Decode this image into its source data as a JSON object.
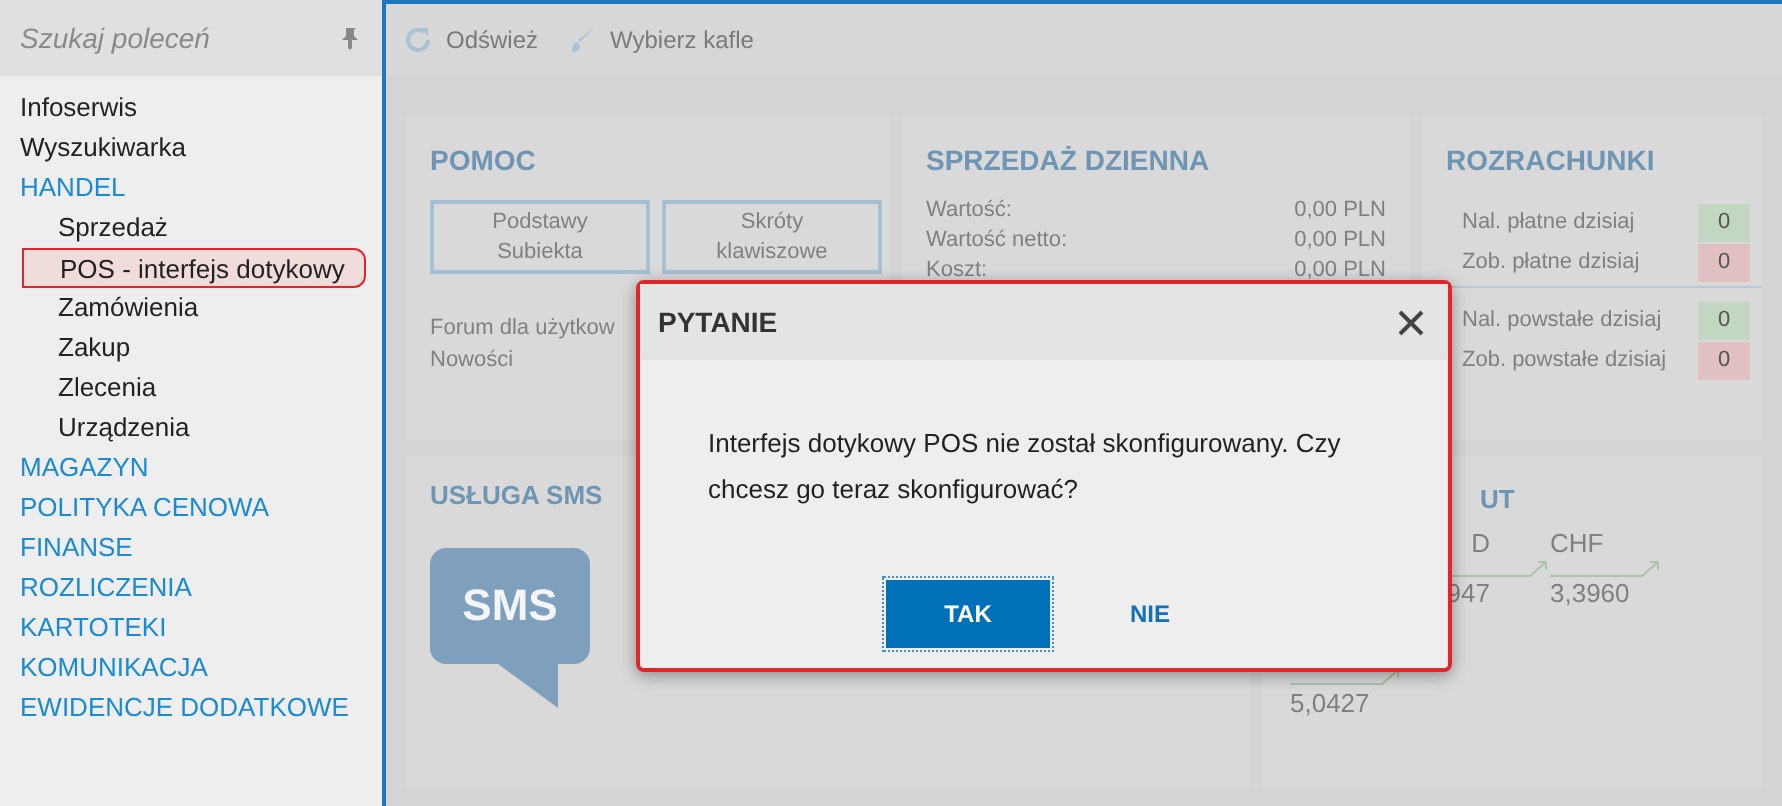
{
  "sidebar": {
    "search": {
      "placeholder": "Szukaj poleceń"
    },
    "items": [
      {
        "label": "Infoserwis",
        "kind": "link",
        "selected": false
      },
      {
        "label": "Wyszukiwarka",
        "kind": "link",
        "selected": false
      },
      {
        "label": "HANDEL",
        "kind": "group",
        "selected": false,
        "children": [
          {
            "label": "Sprzedaż",
            "selected": false
          },
          {
            "label": "POS - interfejs dotykowy",
            "selected": true
          },
          {
            "label": "Zamówienia",
            "selected": false
          },
          {
            "label": "Zakup",
            "selected": false
          },
          {
            "label": "Zlecenia",
            "selected": false
          },
          {
            "label": "Urządzenia",
            "selected": false
          }
        ]
      },
      {
        "label": "MAGAZYN",
        "kind": "group",
        "selected": false
      },
      {
        "label": "POLITYKA CENOWA",
        "kind": "group",
        "selected": false
      },
      {
        "label": "FINANSE",
        "kind": "group",
        "selected": false
      },
      {
        "label": "ROZLICZENIA",
        "kind": "group",
        "selected": false
      },
      {
        "label": "KARTOTEKI",
        "kind": "group",
        "selected": false
      },
      {
        "label": "KOMUNIKACJA",
        "kind": "group",
        "selected": false
      },
      {
        "label": "EWIDENCJE DODATKOWE",
        "kind": "group",
        "selected": false
      }
    ]
  },
  "toolbar": [
    {
      "label": "Odśwież",
      "kind": "refresh"
    },
    {
      "label": "Wybierz kafle",
      "kind": "brush"
    }
  ],
  "tiles": {
    "pomoc": {
      "title": "POMOC",
      "buttons": [
        "Podstawy Subiekta",
        "Skróty klawiszowe"
      ],
      "links": [
        "Forum dla użytkow",
        "Nowości"
      ]
    },
    "sprzedaz": {
      "title": "SPRZEDAŻ DZIENNA",
      "rows": [
        {
          "label": "Wartość:",
          "value": "0,00 PLN"
        },
        {
          "label": "Wartość netto:",
          "value": "0,00 PLN"
        },
        {
          "label": "Koszt:",
          "value": "0,00 PLN"
        }
      ]
    },
    "rozrachunki": {
      "title": "ROZRACHUNKI",
      "groups": [
        [
          {
            "label": "Nal. płatne dzisiaj",
            "count": "0",
            "color": "#c2d6c2"
          },
          {
            "label": "Zob. płatne dzisiaj",
            "count": "0",
            "color": "#e0c0c0"
          }
        ],
        [
          {
            "label": "Nal. powstałe dzisiaj",
            "count": "0",
            "color": "#c2d6c2"
          },
          {
            "label": "Zob. powstałe dzisiaj",
            "count": "0",
            "color": "#e0c0c0"
          }
        ]
      ]
    },
    "sms": {
      "title": "USŁUGA SMS",
      "icon_text": "SMS"
    },
    "kursy": {
      "title": "UT",
      "rates": [
        {
          "code": "D",
          "value": "947"
        },
        {
          "code": "CHF",
          "value": "3,3960"
        }
      ],
      "second_row_value": "5,0427"
    }
  },
  "dialog": {
    "title": "PYTANIE",
    "message": "Interfejs dotykowy POS nie został skonfigurowany. Czy chcesz go teraz skonfigurować?",
    "buttons": [
      {
        "label": "TAK",
        "kind": "primary"
      },
      {
        "label": "NIE",
        "kind": "secondary"
      }
    ]
  }
}
